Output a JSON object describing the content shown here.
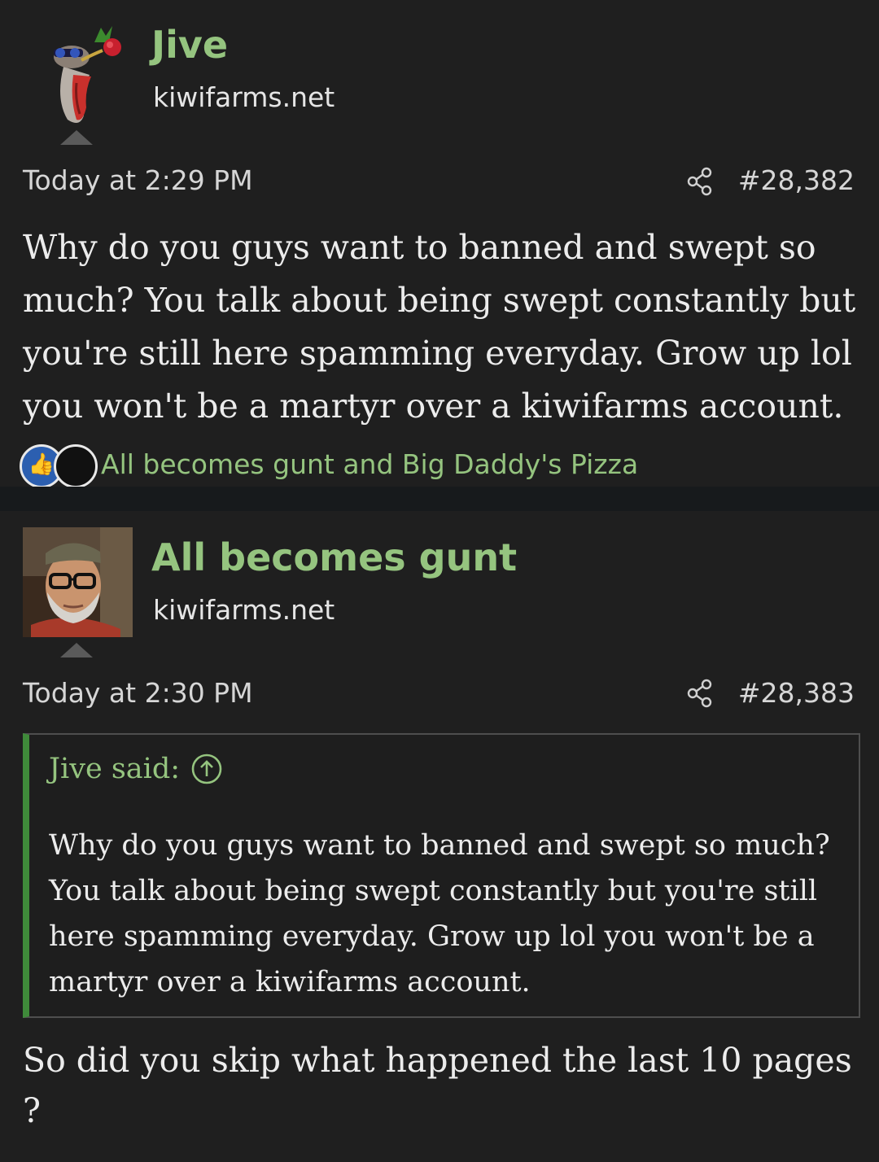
{
  "posts": [
    {
      "username": "Jive",
      "user_site": "kiwifarms.net",
      "timestamp": "Today at 2:29 PM",
      "post_number": "#28,382",
      "body": "Why do you guys want to banned and swept so much? You talk about being swept constantly but you're still here spamming everyday. Grow up lol you won't be a martyr over a kiwifarms account.",
      "reactions": {
        "reactors": "All becomes gunt and Big Daddy's Pizza"
      }
    },
    {
      "username": "All becomes gunt",
      "user_site": "kiwifarms.net",
      "timestamp": "Today at 2:30 PM",
      "post_number": "#28,383",
      "quote": {
        "author": "Jive said:",
        "text": "Why do you guys want to banned and swept so much? You talk about being swept constantly but you're still here spamming everyday. Grow up lol you won't be a martyr over a kiwifarms account."
      },
      "body": "So did you skip what happened the last 10 pages ?"
    }
  ],
  "icons": {
    "share": "share-icon",
    "quote_jump": "arrow-up-circle-icon",
    "like": "thumbs-up-icon"
  },
  "colors": {
    "background": "#1f1f1f",
    "username": "#95c47f",
    "quote_bar": "#3f8a3a"
  }
}
